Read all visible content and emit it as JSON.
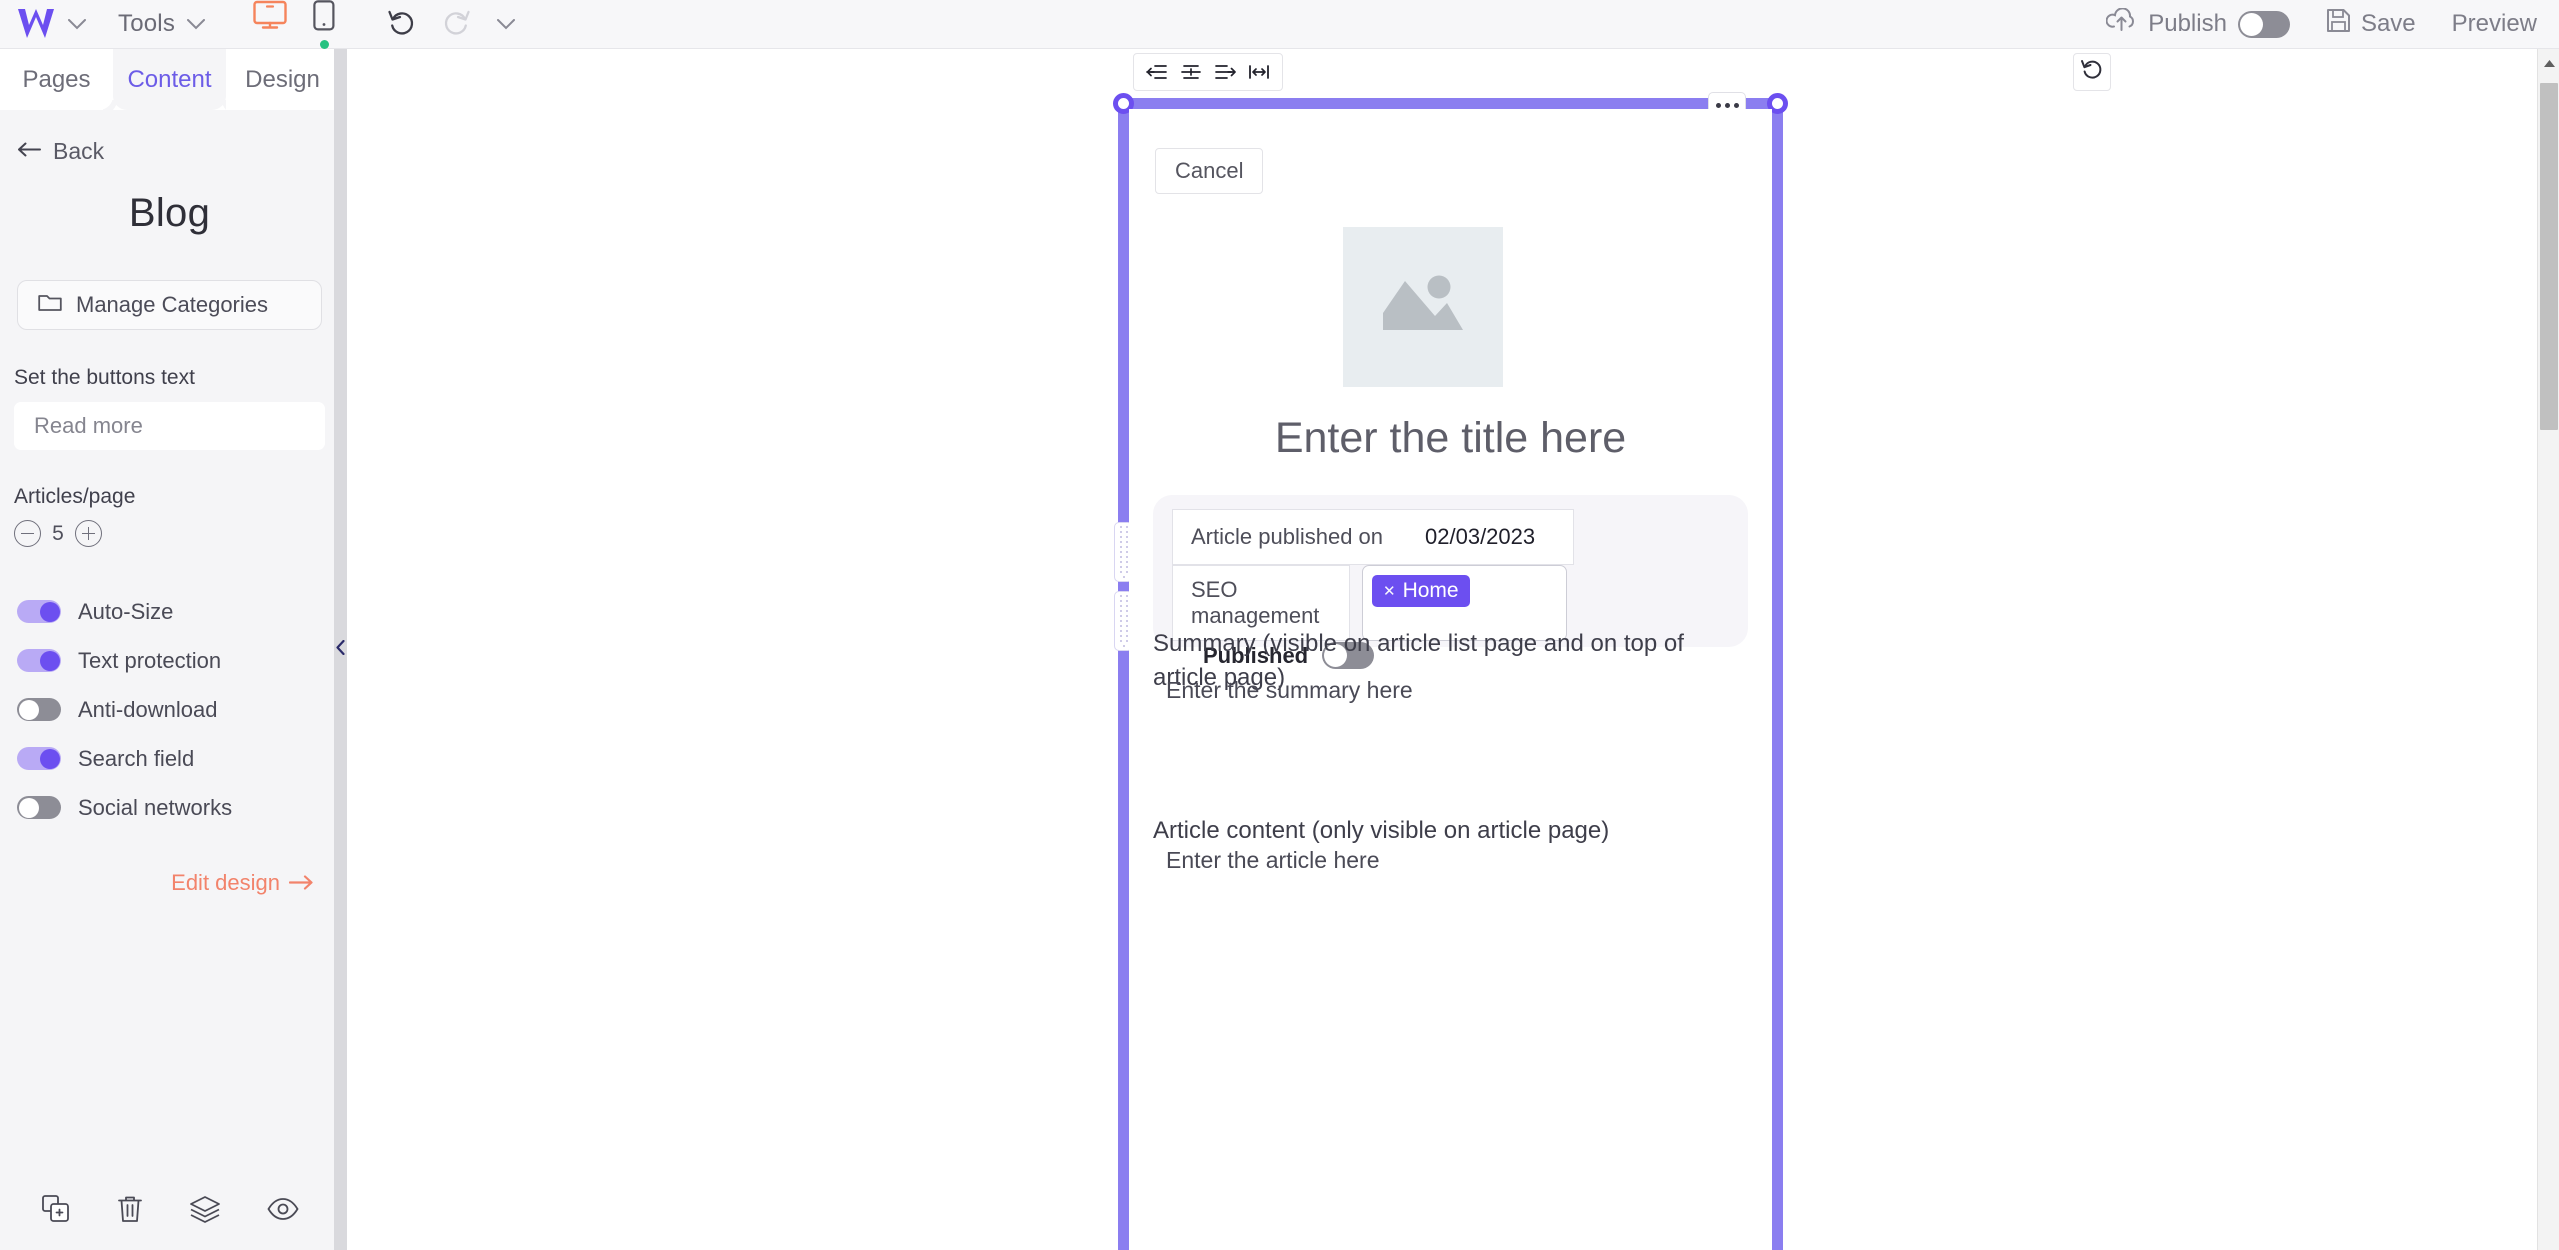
{
  "topbar": {
    "logo": "w-logo-icon",
    "logo_dropdown": "chevron-down-icon",
    "tools_label": "Tools",
    "tools_chevron": "chevron-down-icon",
    "desktop_icon": "desktop-view-icon",
    "mobile_icon": "mobile-view-icon",
    "undo_icon": "undo-icon",
    "redo_icon": "redo-icon",
    "history_chevron": "chevron-down-icon",
    "publish_label": "Publish",
    "publish_icon": "cloud-upload-icon",
    "publish_toggle_on": false,
    "save_label": "Save",
    "save_icon": "floppy-disk-icon",
    "preview_label": "Preview",
    "accent_orange": "#f5845c",
    "accent_purple": "#6c4ff0",
    "status_dot_green": "#26c281"
  },
  "sidebar": {
    "tabs": [
      {
        "label": "Pages",
        "active": false
      },
      {
        "label": "Content",
        "active": true
      },
      {
        "label": "Design",
        "active": false
      }
    ],
    "back_label": "Back",
    "back_icon": "arrow-left-icon",
    "title": "Blog",
    "manage_categories": {
      "label": "Manage Categories",
      "icon": "folder-icon"
    },
    "buttons_text": {
      "label": "Set the buttons text",
      "value": "Read more",
      "placeholder": "Read more"
    },
    "articles_per_page": {
      "label": "Articles/page",
      "value": "5",
      "decrement_icon": "minus-circle-icon",
      "increment_icon": "plus-circle-icon"
    },
    "toggles": [
      {
        "label": "Auto-Size",
        "on": true
      },
      {
        "label": "Text protection",
        "on": true
      },
      {
        "label": "Anti-download",
        "on": false
      },
      {
        "label": "Search field",
        "on": true
      },
      {
        "label": "Social networks",
        "on": false
      }
    ],
    "edit_design": {
      "label": "Edit design",
      "arrow": "arrow-right-icon",
      "color": "#f2836b"
    },
    "bottom_icons": [
      "duplicate-icon",
      "trash-icon",
      "layers-icon",
      "eye-icon"
    ],
    "collapse_icon": "chevron-left-icon"
  },
  "canvas": {
    "align_toolbar": [
      "align-left-icon",
      "align-center-icon",
      "align-right-icon",
      "fit-width-icon"
    ],
    "reload_icon": "reload-icon",
    "selection": {
      "more_menu": "ellipsis-icon",
      "handle_color": "#6c4ff0",
      "frame_color": "#8b7ef0"
    },
    "page": {
      "cancel_label": "Cancel",
      "image_placeholder_icon": "image-placeholder-icon",
      "title_placeholder": "Enter the title here",
      "meta": {
        "published_on_label": "Article published on",
        "published_on_value": "02/03/2023",
        "seo_label": "SEO management",
        "tags": [
          {
            "label": "Home",
            "remove_icon": "close-icon"
          }
        ],
        "published_label": "Published",
        "published_on": false
      },
      "summary_heading": "Summary (visible on article list page and on top of article page)",
      "summary_placeholder": "Enter the summary here",
      "article_heading": "Article content (only visible on article page)",
      "article_placeholder": "Enter the article here"
    }
  },
  "scrollbar": {
    "up_arrow_icon": "scroll-up-icon"
  }
}
